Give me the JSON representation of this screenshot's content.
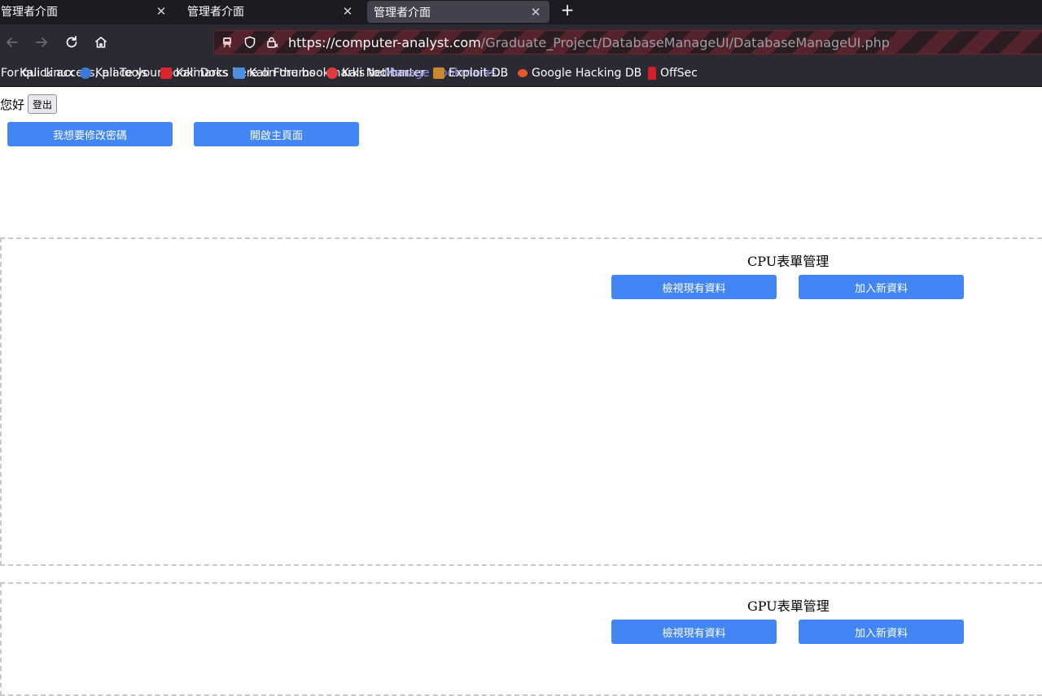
{
  "tabs": [
    {
      "title": "管理者介面",
      "close": "✕"
    },
    {
      "title": "管理者介面",
      "close": "✕"
    },
    {
      "title": "管理者介面",
      "close": "✕"
    }
  ],
  "new_tab_symbol": "+",
  "url": {
    "host_part": "https://computer-analyst.com",
    "path_part": "/Graduate_Project/DatabaseManageUI/DatabaseManageUI.php"
  },
  "bookmarks_overlap": [
    {
      "text": "For quick access, place your bookmarks here on the bookmarks toolbar."
    },
    {
      "text": "Kali Linux",
      "icon": "kali-linux-icon"
    },
    {
      "text": "Kali Tools",
      "icon": "kali-tools-icon"
    },
    {
      "text": "Kali Docs",
      "icon": "kali-docs-icon"
    },
    {
      "text": "Kali Forums",
      "icon": "kali-forums-icon"
    },
    {
      "text": "Kali NetHunter",
      "icon": "kali-nethunter-icon"
    },
    {
      "text": "Manage bookmarks..."
    },
    {
      "text": "Exploit-DB",
      "icon": "exploit-db-icon"
    }
  ],
  "bookmarks": [
    {
      "text": "Google Hacking DB",
      "icon": "google-hacking-db-icon"
    },
    {
      "text": "OffSec",
      "icon": "offsec-icon"
    }
  ],
  "page": {
    "greeting": "您好",
    "logout_label": "登出",
    "change_password_label": "我想要修改密碼",
    "open_home_label": "開啟主頁面"
  },
  "panels": [
    {
      "title": "CPU表單管理",
      "view_label": "檢視現有資料",
      "add_label": "加入新資料"
    },
    {
      "title": "GPU表單管理",
      "view_label": "檢視現有資料",
      "add_label": "加入新資料"
    }
  ],
  "colors": {
    "accent_button": "#4285f4",
    "chrome_dark": "#2b2a33",
    "tabbar": "#1c1b22"
  }
}
